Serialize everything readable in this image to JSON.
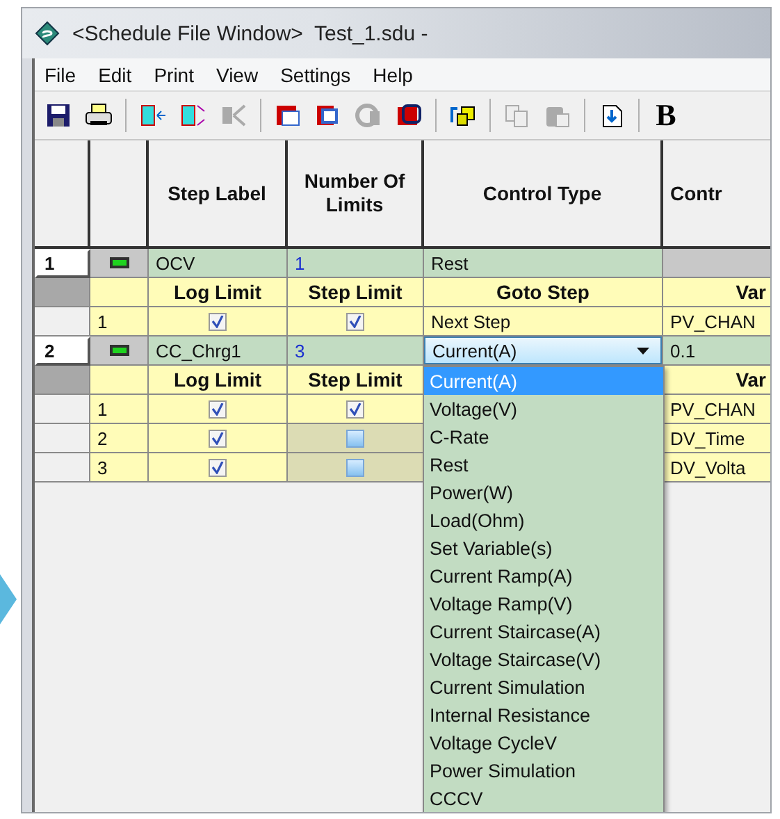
{
  "window": {
    "title": "<Schedule File Window>  Test_1.sdu -"
  },
  "menu": [
    "File",
    "Edit",
    "Print",
    "View",
    "Settings",
    "Help"
  ],
  "toolbar": [
    {
      "kind": "save",
      "disabled": false
    },
    {
      "kind": "print",
      "disabled": false
    },
    {
      "kind": "sep"
    },
    {
      "kind": "insert",
      "disabled": false
    },
    {
      "kind": "insert-below",
      "disabled": false
    },
    {
      "kind": "delete",
      "disabled": true
    },
    {
      "kind": "sep"
    },
    {
      "kind": "step-s",
      "disabled": false
    },
    {
      "kind": "step-l",
      "disabled": false
    },
    {
      "kind": "step-c",
      "disabled": true
    },
    {
      "kind": "step-n",
      "disabled": false
    },
    {
      "kind": "sep"
    },
    {
      "kind": "swap",
      "disabled": false
    },
    {
      "kind": "sep"
    },
    {
      "kind": "copy",
      "disabled": true
    },
    {
      "kind": "paste",
      "disabled": true
    },
    {
      "kind": "sep"
    },
    {
      "kind": "import",
      "disabled": false
    },
    {
      "kind": "sep"
    },
    {
      "kind": "bold",
      "label": "B",
      "disabled": false
    }
  ],
  "table": {
    "columns": [
      "Step Label",
      "Number Of Limits",
      "Control Type",
      "Contr"
    ]
  },
  "steps": [
    {
      "number": "1",
      "expanded": true,
      "label": "OCV",
      "limit_count": "1",
      "control_type": "Rest",
      "limit_headers": [
        "Log Limit",
        "Step Limit",
        "Goto Step",
        "Var"
      ],
      "limits": [
        {
          "number": "1",
          "log_limit": true,
          "step_limit": true,
          "goto": "Next Step",
          "variable": "PV_CHAN"
        }
      ]
    },
    {
      "number": "2",
      "expanded": true,
      "label": "CC_Chrg1",
      "limit_count": "3",
      "control_type": "Current(A)",
      "control_type_open": true,
      "control_value": "0.1",
      "limit_headers": [
        "Log Limit",
        "Step Limit",
        "Var"
      ],
      "limits": [
        {
          "number": "1",
          "log_limit": true,
          "step_limit": true,
          "variable": "PV_CHAN"
        },
        {
          "number": "2",
          "log_limit": true,
          "step_limit": false,
          "variable": "DV_Time"
        },
        {
          "number": "3",
          "log_limit": true,
          "step_limit": false,
          "variable": "DV_Volta"
        }
      ]
    }
  ],
  "dropdown": {
    "options": [
      {
        "label": "Current(A)",
        "selected": true
      },
      {
        "label": "Voltage(V)",
        "selected": false
      },
      {
        "label": "C-Rate",
        "selected": false
      },
      {
        "label": "Rest",
        "selected": false
      },
      {
        "label": "Power(W)",
        "selected": false
      },
      {
        "label": "Load(Ohm)",
        "selected": false
      },
      {
        "label": "Set Variable(s)",
        "selected": false
      },
      {
        "label": "Current Ramp(A)",
        "selected": false
      },
      {
        "label": "Voltage Ramp(V)",
        "selected": false
      },
      {
        "label": "Current Staircase(A)",
        "selected": false
      },
      {
        "label": "Voltage Staircase(V)",
        "selected": false
      },
      {
        "label": "Current Simulation",
        "selected": false
      },
      {
        "label": "Internal Resistance",
        "selected": false
      },
      {
        "label": "Voltage CycleV",
        "selected": false
      },
      {
        "label": "Power Simulation",
        "selected": false
      },
      {
        "label": "CCCV",
        "selected": false
      }
    ]
  }
}
